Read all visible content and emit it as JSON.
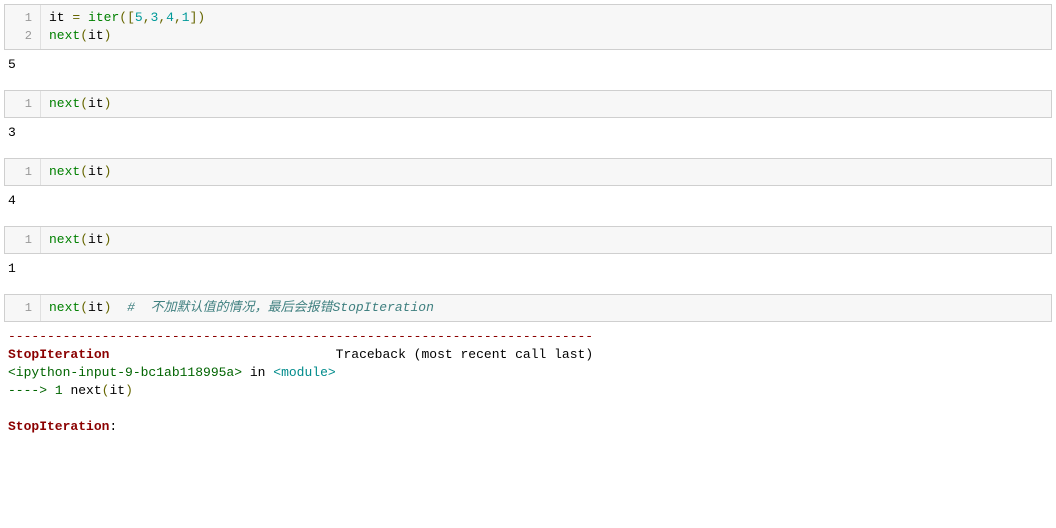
{
  "cells": [
    {
      "lines": [
        {
          "no": "1",
          "tokens": [
            {
              "t": "it",
              "c": "tok-name"
            },
            {
              "t": " ",
              "c": ""
            },
            {
              "t": "=",
              "c": "tok-op"
            },
            {
              "t": " ",
              "c": ""
            },
            {
              "t": "iter",
              "c": "tok-builtin"
            },
            {
              "t": "([",
              "c": "tok-punct"
            },
            {
              "t": "5",
              "c": "tok-number"
            },
            {
              "t": ",",
              "c": "tok-punct"
            },
            {
              "t": "3",
              "c": "tok-number"
            },
            {
              "t": ",",
              "c": "tok-punct"
            },
            {
              "t": "4",
              "c": "tok-number"
            },
            {
              "t": ",",
              "c": "tok-punct"
            },
            {
              "t": "1",
              "c": "tok-number"
            },
            {
              "t": "])",
              "c": "tok-punct"
            }
          ]
        },
        {
          "no": "2",
          "tokens": [
            {
              "t": "next",
              "c": "tok-builtin"
            },
            {
              "t": "(",
              "c": "tok-punct"
            },
            {
              "t": "it",
              "c": "tok-name"
            },
            {
              "t": ")",
              "c": "tok-punct"
            }
          ]
        }
      ],
      "output": "5"
    },
    {
      "lines": [
        {
          "no": "1",
          "tokens": [
            {
              "t": "next",
              "c": "tok-builtin"
            },
            {
              "t": "(",
              "c": "tok-punct"
            },
            {
              "t": "it",
              "c": "tok-name"
            },
            {
              "t": ")",
              "c": "tok-punct"
            }
          ]
        }
      ],
      "output": "3"
    },
    {
      "lines": [
        {
          "no": "1",
          "tokens": [
            {
              "t": "next",
              "c": "tok-builtin"
            },
            {
              "t": "(",
              "c": "tok-punct"
            },
            {
              "t": "it",
              "c": "tok-name"
            },
            {
              "t": ")",
              "c": "tok-punct"
            }
          ]
        }
      ],
      "output": "4"
    },
    {
      "lines": [
        {
          "no": "1",
          "tokens": [
            {
              "t": "next",
              "c": "tok-builtin"
            },
            {
              "t": "(",
              "c": "tok-punct"
            },
            {
              "t": "it",
              "c": "tok-name"
            },
            {
              "t": ")",
              "c": "tok-punct"
            }
          ]
        }
      ],
      "output": "1"
    },
    {
      "lines": [
        {
          "no": "1",
          "tokens": [
            {
              "t": "next",
              "c": "tok-builtin"
            },
            {
              "t": "(",
              "c": "tok-punct"
            },
            {
              "t": "it",
              "c": "tok-name"
            },
            {
              "t": ")",
              "c": "tok-punct"
            },
            {
              "t": "  ",
              "c": ""
            },
            {
              "t": "#  不加默认值的情况，最后会报错StopIteration",
              "c": "tok-comment"
            }
          ]
        }
      ],
      "traceback": {
        "sep": "---------------------------------------------------------------------------",
        "errname": "StopIteration",
        "spacer": "                             ",
        "trace_label": "Traceback (most recent call last)",
        "input_ref": "<ipython-input-9-bc1ab118995a>",
        "in_word": " in ",
        "module_ref": "<module>",
        "arrow": "----> ",
        "lineno": "1",
        "space": " ",
        "call_next": "next",
        "call_open": "(",
        "call_arg": "it",
        "call_close": ")",
        "final_err": "StopIteration",
        "final_colon": ": "
      }
    }
  ]
}
